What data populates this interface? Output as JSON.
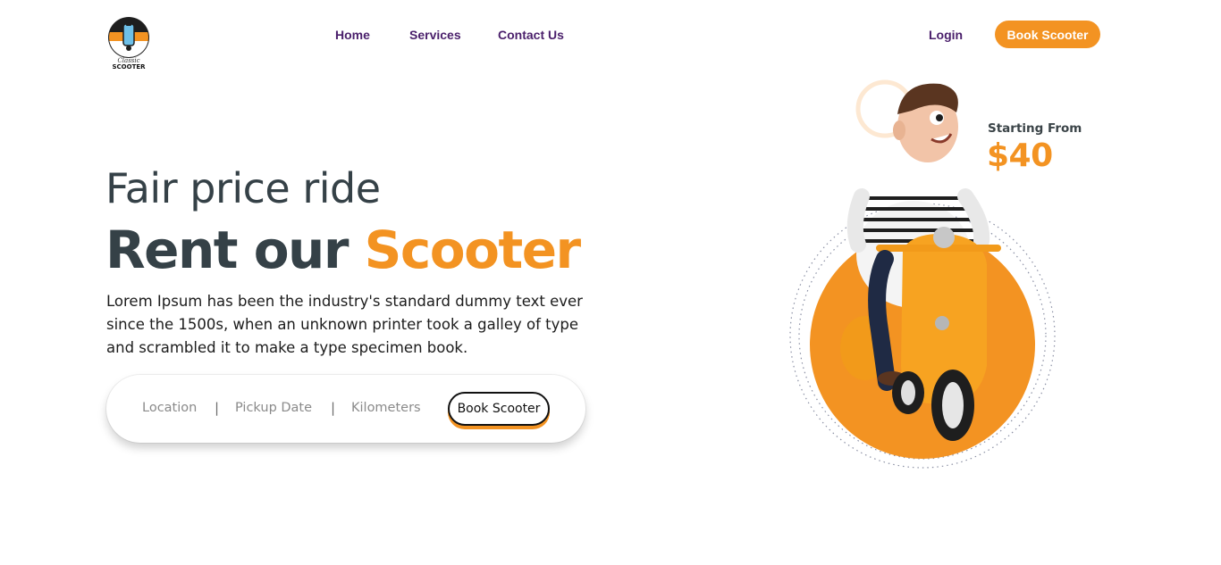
{
  "brand": {
    "name": "SCOOTER",
    "tagline": "Classic",
    "colors": {
      "accent": "#f39322",
      "nav_text": "#4a1f6b",
      "heading": "#354147"
    }
  },
  "nav": {
    "links": [
      "Home",
      "Services",
      "Contact Us"
    ],
    "login": "Login",
    "cta": "Book Scooter"
  },
  "hero": {
    "subtitle": "Fair price ride",
    "title_plain": "Rent our ",
    "title_accent": "Scooter",
    "description": "Lorem Ipsum has been the industry's standard dummy text ever since the 1500s, when an unknown printer took a galley of type and scrambled it to make a type specimen book."
  },
  "booking": {
    "fields": [
      "Location",
      "Pickup Date",
      "Kilometers"
    ],
    "separator": "|",
    "button": "Book Scooter"
  },
  "promo": {
    "label": "Starting From",
    "price": "$40"
  },
  "icons": {
    "logo": "scooter-logo-icon",
    "illustration": "man-riding-scooter-illustration"
  }
}
